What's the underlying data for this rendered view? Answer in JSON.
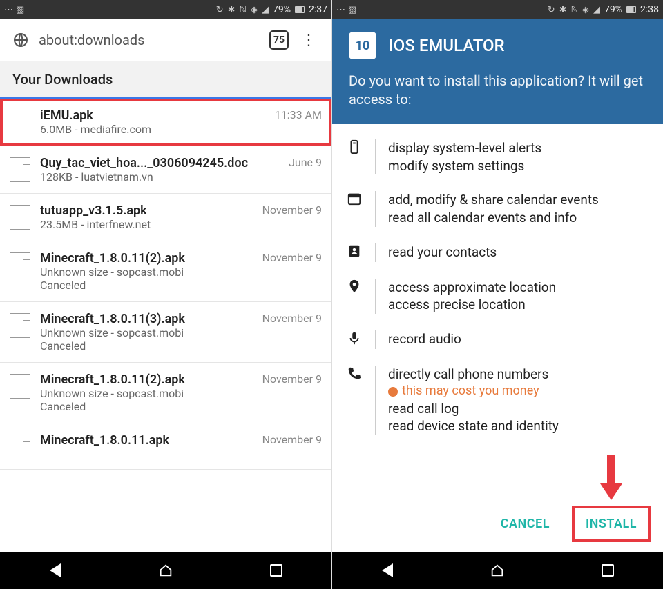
{
  "left": {
    "status": {
      "battery": "79%",
      "time": "2:37"
    },
    "address_bar": {
      "url_text": "about:downloads",
      "tab_count": "75"
    },
    "section_title": "Your Downloads",
    "downloads": [
      {
        "name": "iEMU.apk",
        "size": "6.0MB",
        "source": "mediafire.com",
        "time": "11:33 AM",
        "status": "",
        "highlighted": true
      },
      {
        "name": "Quy_tac_viet_hoa..._0306094245.doc",
        "size": "128KB",
        "source": "luatvietnam.vn",
        "time": "June 9",
        "status": ""
      },
      {
        "name": "tutuapp_v3.1.5.apk",
        "size": "23.5MB",
        "source": "interfnew.net",
        "time": "November 9",
        "status": ""
      },
      {
        "name": "Minecraft_1.8.0.11(2).apk",
        "size": "Unknown size",
        "source": "sopcast.mobi",
        "time": "November 9",
        "status": "Canceled"
      },
      {
        "name": "Minecraft_1.8.0.11(3).apk",
        "size": "Unknown size",
        "source": "sopcast.mobi",
        "time": "November 9",
        "status": "Canceled"
      },
      {
        "name": "Minecraft_1.8.0.11(2).apk",
        "size": "Unknown size",
        "source": "sopcast.mobi",
        "time": "November 9",
        "status": "Canceled"
      },
      {
        "name": "Minecraft_1.8.0.11.apk",
        "size": "",
        "source": "",
        "time": "November 9",
        "status": ""
      }
    ]
  },
  "right": {
    "status": {
      "battery": "79%",
      "time": "2:38"
    },
    "app_icon_text": "10",
    "app_name": "IOS EMULATOR",
    "prompt": "Do you want to install this application? It will get access to:",
    "permissions": [
      {
        "icon": "device",
        "lines": [
          "display system-level alerts",
          "modify system settings"
        ]
      },
      {
        "icon": "calendar",
        "lines": [
          "add, modify & share calendar events",
          "read all calendar events and info"
        ]
      },
      {
        "icon": "contacts",
        "lines": [
          "read your contacts"
        ]
      },
      {
        "icon": "location",
        "lines": [
          "access approximate location",
          "access precise location"
        ]
      },
      {
        "icon": "mic",
        "lines": [
          "record audio"
        ]
      },
      {
        "icon": "phone",
        "lines": [
          "directly call phone numbers"
        ],
        "warning": "this may cost you money",
        "extra": [
          "read call log",
          "read device state and identity"
        ]
      }
    ],
    "actions": {
      "cancel": "CANCEL",
      "install": "INSTALL"
    }
  }
}
